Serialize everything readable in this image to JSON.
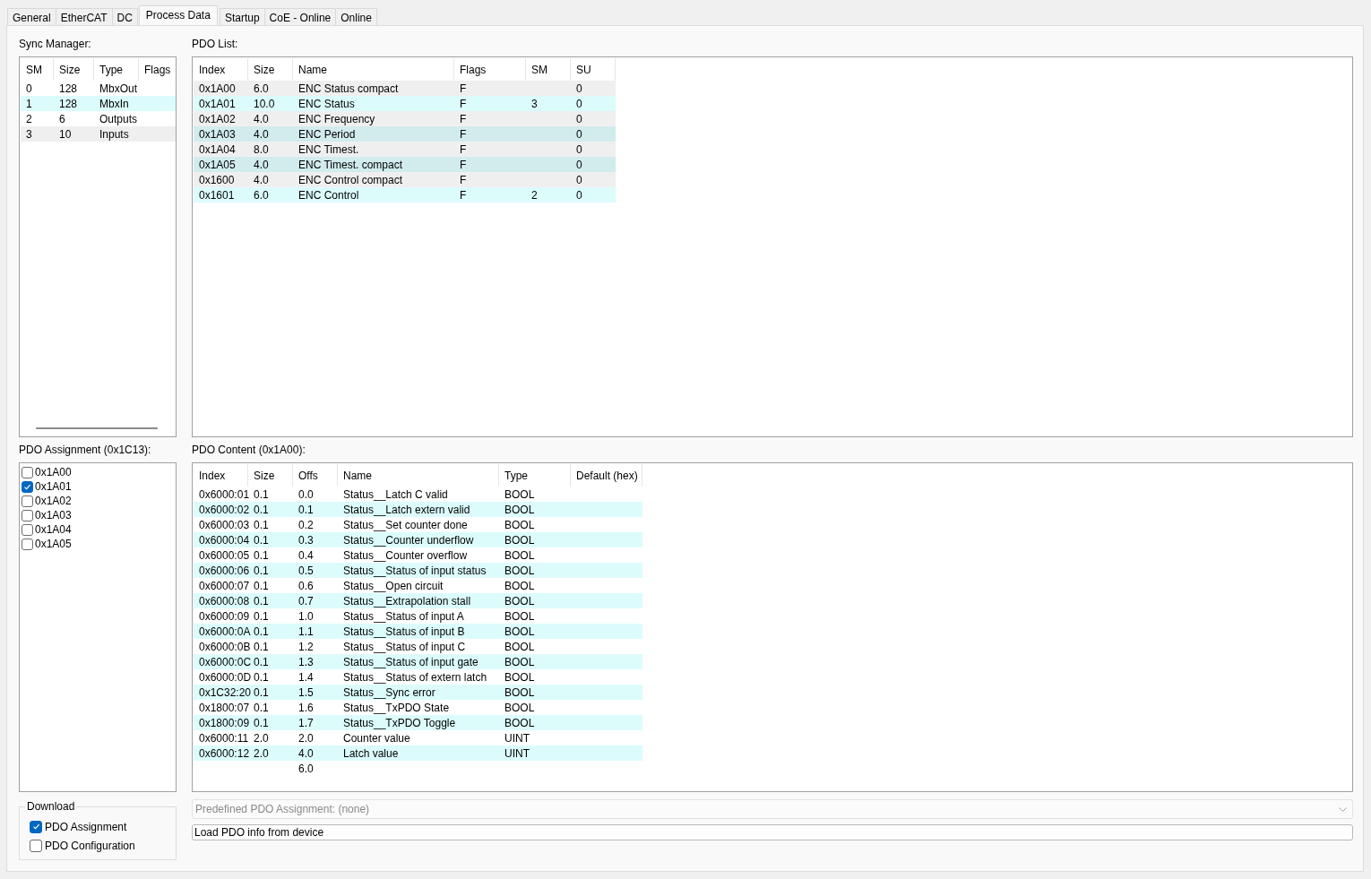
{
  "tabs": [
    {
      "label": "General",
      "selected": false
    },
    {
      "label": "EtherCAT",
      "selected": false
    },
    {
      "label": "DC",
      "selected": false
    },
    {
      "label": "Process Data",
      "selected": true
    },
    {
      "label": "Startup",
      "selected": false
    },
    {
      "label": "CoE - Online",
      "selected": false
    },
    {
      "label": "Online",
      "selected": false
    }
  ],
  "sync_manager": {
    "label": "Sync Manager:",
    "columns": [
      "SM",
      "Size",
      "Type",
      "Flags"
    ],
    "rows": [
      {
        "cells": [
          "0",
          "128",
          "MbxOut",
          ""
        ],
        "color": "#ffffff"
      },
      {
        "cells": [
          "1",
          "128",
          "MbxIn",
          ""
        ],
        "color": "#dcfcfc"
      },
      {
        "cells": [
          "2",
          "6",
          "Outputs",
          ""
        ],
        "color": "#ffffff"
      },
      {
        "cells": [
          "3",
          "10",
          "Inputs",
          ""
        ],
        "color": "#efefef"
      }
    ]
  },
  "pdo_list": {
    "label": "PDO List:",
    "columns": [
      "Index",
      "Size",
      "Name",
      "Flags",
      "SM",
      "SU"
    ],
    "rows": [
      {
        "cells": [
          "0x1A00",
          "6.0",
          "ENC Status compact",
          "F",
          "",
          "0"
        ],
        "color": "#efefef"
      },
      {
        "cells": [
          "0x1A01",
          "10.0",
          "ENC Status",
          "F",
          "3",
          "0"
        ],
        "color": "#dcfcfc"
      },
      {
        "cells": [
          "0x1A02",
          "4.0",
          "ENC Frequency",
          "F",
          "",
          "0"
        ],
        "color": "#efefef"
      },
      {
        "cells": [
          "0x1A03",
          "4.0",
          "ENC Period",
          "F",
          "",
          "0"
        ],
        "color": "#d2ecee"
      },
      {
        "cells": [
          "0x1A04",
          "8.0",
          "ENC Timest.",
          "F",
          "",
          "0"
        ],
        "color": "#efefef"
      },
      {
        "cells": [
          "0x1A05",
          "4.0",
          "ENC Timest. compact",
          "F",
          "",
          "0"
        ],
        "color": "#d2ecee"
      },
      {
        "cells": [
          "0x1600",
          "4.0",
          "ENC Control compact",
          "F",
          "",
          "0"
        ],
        "color": "#efefef"
      },
      {
        "cells": [
          "0x1601",
          "6.0",
          "ENC Control",
          "F",
          "2",
          "0"
        ],
        "color": "#dcfcfc"
      }
    ]
  },
  "pdo_assignment": {
    "label": "PDO Assignment (0x1C13):",
    "items": [
      {
        "label": "0x1A00",
        "checked": false
      },
      {
        "label": "0x1A01",
        "checked": true
      },
      {
        "label": "0x1A02",
        "checked": false
      },
      {
        "label": "0x1A03",
        "checked": false
      },
      {
        "label": "0x1A04",
        "checked": false
      },
      {
        "label": "0x1A05",
        "checked": false
      }
    ]
  },
  "pdo_content": {
    "label": "PDO Content (0x1A00):",
    "columns": [
      "Index",
      "Size",
      "Offs",
      "Name",
      "Type",
      "Default (hex)"
    ],
    "rows": [
      [
        "0x6000:01",
        "0.1",
        "0.0",
        "Status__Latch C valid",
        "BOOL",
        ""
      ],
      [
        "0x6000:02",
        "0.1",
        "0.1",
        "Status__Latch extern valid",
        "BOOL",
        ""
      ],
      [
        "0x6000:03",
        "0.1",
        "0.2",
        "Status__Set counter done",
        "BOOL",
        ""
      ],
      [
        "0x6000:04",
        "0.1",
        "0.3",
        "Status__Counter underflow",
        "BOOL",
        ""
      ],
      [
        "0x6000:05",
        "0.1",
        "0.4",
        "Status__Counter overflow",
        "BOOL",
        ""
      ],
      [
        "0x6000:06",
        "0.1",
        "0.5",
        "Status__Status of input status",
        "BOOL",
        ""
      ],
      [
        "0x6000:07",
        "0.1",
        "0.6",
        "Status__Open circuit",
        "BOOL",
        ""
      ],
      [
        "0x6000:08",
        "0.1",
        "0.7",
        "Status__Extrapolation stall",
        "BOOL",
        ""
      ],
      [
        "0x6000:09",
        "0.1",
        "1.0",
        "Status__Status of input A",
        "BOOL",
        ""
      ],
      [
        "0x6000:0A",
        "0.1",
        "1.1",
        "Status__Status of input B",
        "BOOL",
        ""
      ],
      [
        "0x6000:0B",
        "0.1",
        "1.2",
        "Status__Status of input C",
        "BOOL",
        ""
      ],
      [
        "0x6000:0C",
        "0.1",
        "1.3",
        "Status__Status of input gate",
        "BOOL",
        ""
      ],
      [
        "0x6000:0D",
        "0.1",
        "1.4",
        "Status__Status of extern latch",
        "BOOL",
        ""
      ],
      [
        "0x1C32:20",
        "0.1",
        "1.5",
        "Status__Sync error",
        "BOOL",
        ""
      ],
      [
        "0x1800:07",
        "0.1",
        "1.6",
        "Status__TxPDO State",
        "BOOL",
        ""
      ],
      [
        "0x1800:09",
        "0.1",
        "1.7",
        "Status__TxPDO Toggle",
        "BOOL",
        ""
      ],
      [
        "0x6000:11",
        "2.0",
        "2.0",
        "Counter value",
        "UINT",
        ""
      ],
      [
        "0x6000:12",
        "2.0",
        "4.0",
        "Latch value",
        "UINT",
        ""
      ],
      [
        "",
        "",
        "6.0",
        "",
        "",
        ""
      ]
    ]
  },
  "download": {
    "label": "Download",
    "items": [
      {
        "label": "PDO Assignment",
        "checked": true
      },
      {
        "label": "PDO Configuration",
        "checked": false
      }
    ]
  },
  "predefined_dropdown": {
    "value": "Predefined PDO Assignment: (none)",
    "disabled": true
  },
  "load_button": {
    "label": "Load PDO info from device"
  }
}
